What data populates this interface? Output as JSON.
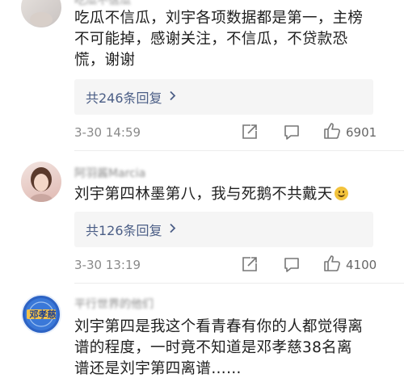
{
  "comments": [
    {
      "username": "吃瓜不信瓜",
      "lines": [
        "吃瓜不信瓜，刘宇各项数据都是第一，主榜",
        "不可能掉，感谢关注，不信瓜，不贷款恐",
        "慌，谢谢"
      ],
      "replies_label": "共246条回复",
      "timestamp": "3-30 14:59",
      "likes": "6901"
    },
    {
      "username": "阿羽酱Marcia",
      "lines": [
        "刘宇第四林墨第八，我与死鹅不共戴天"
      ],
      "emoji": "smile-emoji",
      "replies_label": "共126条回复",
      "timestamp": "3-30 13:19",
      "likes": "4100"
    },
    {
      "username": "平行世界的他们",
      "lines": [
        "刘宇第四是我这个看青春有你的人都觉得离",
        "谱的程度，一时竟不知道是邓孝慈38名离",
        "谱还是刘宇第四离谱……"
      ],
      "avatar_text": "邓孝慈"
    }
  ],
  "icons": {
    "share": "share-icon",
    "comment": "comment-icon",
    "like": "thumbs-up-icon",
    "chevron": "chevron-right-icon"
  },
  "colors": {
    "reply_text": "#4b5e86",
    "meta": "#8a8a8a"
  }
}
